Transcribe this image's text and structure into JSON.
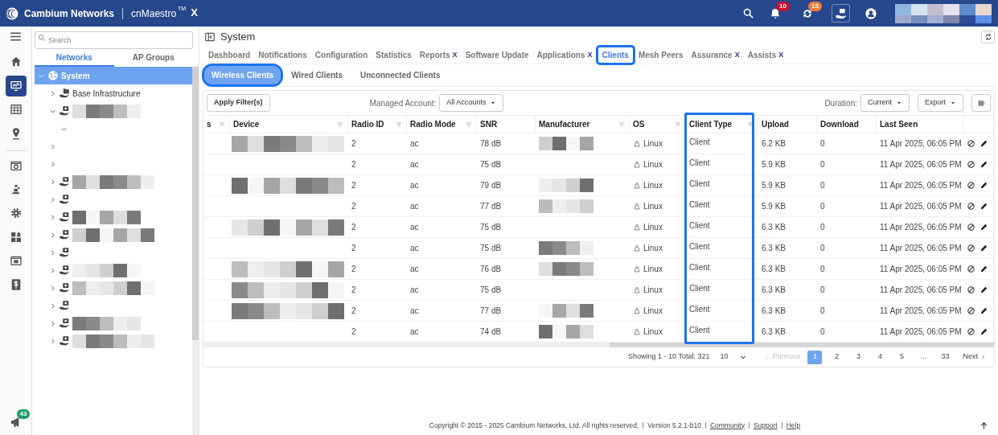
{
  "top_bar": {
    "brand": "Cambium Networks",
    "product": "cnMaestro",
    "trademark": "TM",
    "product_suffix": "X",
    "notifications_badge": "10",
    "sync_badge": "15"
  },
  "rail": {
    "items": [
      {
        "kind": "home",
        "selected": false
      },
      {
        "kind": "monitor",
        "selected": true
      },
      {
        "kind": "table",
        "selected": false
      },
      {
        "kind": "pin",
        "selected": false
      },
      {
        "kind": "dashboard",
        "selected": false
      },
      {
        "kind": "people",
        "selected": false
      },
      {
        "kind": "gear",
        "selected": false
      },
      {
        "kind": "apps",
        "selected": false
      },
      {
        "kind": "camera",
        "selected": false
      },
      {
        "kind": "dollar",
        "selected": false
      }
    ],
    "announce_badge": "43"
  },
  "tree_panel": {
    "search": {
      "placeholder": "Search"
    },
    "tabs": [
      {
        "label": "Networks",
        "selected": true
      },
      {
        "label": "AP Groups",
        "selected": false
      }
    ],
    "tree": [
      {
        "label": "System",
        "kind": "system",
        "expanded": true,
        "selected": true,
        "children": [
          {
            "label": "Base Infrastructure",
            "kind": "folder",
            "expanded": false,
            "selected": false
          },
          {
            "kind": "network",
            "expanded": true,
            "selected": false,
            "children": [
              {
                "expanded": true,
                "selected": false
              }
            ]
          },
          {
            "expanded": false,
            "selected": false
          },
          {
            "expanded": false,
            "selected": false
          },
          {
            "kind": "network",
            "expanded": false,
            "selected": false
          },
          {
            "kind": "network",
            "expanded": false,
            "selected": false
          },
          {
            "kind": "network",
            "expanded": false,
            "selected": false
          },
          {
            "kind": "network",
            "expanded": false,
            "selected": false
          },
          {
            "kind": "network",
            "expanded": false,
            "selected": false
          },
          {
            "kind": "network",
            "expanded": false,
            "selected": false
          },
          {
            "kind": "network",
            "expanded": false,
            "selected": false
          },
          {
            "kind": "network",
            "expanded": false,
            "selected": false
          },
          {
            "kind": "network",
            "expanded": false,
            "selected": false
          },
          {
            "kind": "network",
            "expanded": false,
            "selected": false
          }
        ]
      }
    ]
  },
  "page": {
    "title": "System",
    "tabs": [
      {
        "label": "Dashboard",
        "selected": false,
        "highlighted": false
      },
      {
        "label": "Notifications",
        "selected": false,
        "highlighted": false
      },
      {
        "label": "Configuration",
        "selected": false,
        "highlighted": false
      },
      {
        "label": "Statistics",
        "selected": false,
        "highlighted": false
      },
      {
        "label": "Reports",
        "suffix": "X",
        "selected": false,
        "highlighted": false
      },
      {
        "label": "Software Update",
        "selected": false,
        "highlighted": false
      },
      {
        "label": "Applications",
        "suffix": "X",
        "selected": false,
        "highlighted": false
      },
      {
        "label": "Clients",
        "selected": true,
        "highlighted": true
      },
      {
        "label": "Mesh Peers",
        "selected": false,
        "highlighted": false
      },
      {
        "label": "Assurance",
        "suffix": "X",
        "selected": false,
        "highlighted": false
      },
      {
        "label": "Assists",
        "suffix": "X",
        "selected": false,
        "highlighted": false
      }
    ],
    "subtabs": [
      {
        "label": "Wireless Clients",
        "selected": true,
        "highlighted": true
      },
      {
        "label": "Wired Clients",
        "selected": false,
        "highlighted": false
      },
      {
        "label": "Unconnected Clients",
        "selected": false,
        "highlighted": false
      }
    ]
  },
  "toolbar": {
    "apply_button": "Apply Filter(s)",
    "managed_account_label": "Managed Account:",
    "managed_account": "All Accounts",
    "duration_label": "Duration:",
    "duration": "Current",
    "export_button": "Export"
  },
  "table": {
    "columns": [
      {
        "label": "s",
        "filter": true,
        "highlighted": false
      },
      {
        "label": "Device",
        "filter": true,
        "highlighted": false
      },
      {
        "label": "Radio ID",
        "filter": true,
        "highlighted": false
      },
      {
        "label": "Radio Mode",
        "filter": true,
        "highlighted": false
      },
      {
        "label": "SNR",
        "filter": false,
        "highlighted": false
      },
      {
        "label": "Manufacturer",
        "filter": true,
        "highlighted": false
      },
      {
        "label": "OS",
        "filter": true,
        "highlighted": false
      },
      {
        "label": "Client Type",
        "filter": true,
        "highlighted": true
      },
      {
        "label": "Upload",
        "filter": false,
        "highlighted": false
      },
      {
        "label": "Download",
        "filter": false,
        "highlighted": false
      },
      {
        "label": "Last Seen",
        "filter": false,
        "highlighted": false
      }
    ],
    "rows": [
      {
        "radio_id": "2",
        "radio_mode": "ac",
        "snr": "78 dB",
        "os": "Linux",
        "client_type": "Client",
        "upload": "6.2 KB",
        "download": "0",
        "last_seen": "11 Apr 2025, 06:05 PM"
      },
      {
        "radio_id": "2",
        "radio_mode": "ac",
        "snr": "75 dB",
        "os": "Linux",
        "client_type": "Client",
        "upload": "5.9 KB",
        "download": "0",
        "last_seen": "11 Apr 2025, 06:05 PM"
      },
      {
        "radio_id": "2",
        "radio_mode": "ac",
        "snr": "79 dB",
        "os": "Linux",
        "client_type": "Client",
        "upload": "5.9 KB",
        "download": "0",
        "last_seen": "11 Apr 2025, 06:05 PM"
      },
      {
        "radio_id": "2",
        "radio_mode": "ac",
        "snr": "77 dB",
        "os": "Linux",
        "client_type": "Client",
        "upload": "5.9 KB",
        "download": "0",
        "last_seen": "11 Apr 2025, 06:05 PM"
      },
      {
        "radio_id": "2",
        "radio_mode": "ac",
        "snr": "75 dB",
        "os": "Linux",
        "client_type": "Client",
        "upload": "6.3 KB",
        "download": "0",
        "last_seen": "11 Apr 2025, 06:05 PM"
      },
      {
        "radio_id": "2",
        "radio_mode": "ac",
        "snr": "75 dB",
        "os": "Linux",
        "client_type": "Client",
        "upload": "6.3 KB",
        "download": "0",
        "last_seen": "11 Apr 2025, 06:05 PM"
      },
      {
        "radio_id": "2",
        "radio_mode": "ac",
        "snr": "76 dB",
        "os": "Linux",
        "client_type": "Client",
        "upload": "6.3 KB",
        "download": "0",
        "last_seen": "11 Apr 2025, 06:05 PM"
      },
      {
        "radio_id": "2",
        "radio_mode": "ac",
        "snr": "75 dB",
        "os": "Linux",
        "client_type": "Client",
        "upload": "6.3 KB",
        "download": "0",
        "last_seen": "11 Apr 2025, 06:05 PM"
      },
      {
        "radio_id": "2",
        "radio_mode": "ac",
        "snr": "77 dB",
        "os": "Linux",
        "client_type": "Client",
        "upload": "6.3 KB",
        "download": "0",
        "last_seen": "11 Apr 2025, 06:05 PM"
      },
      {
        "radio_id": "2",
        "radio_mode": "ac",
        "snr": "74 dB",
        "os": "Linux",
        "client_type": "Client",
        "upload": "6.3 KB",
        "download": "0",
        "last_seen": "11 Apr 2025, 06:05 PM"
      }
    ]
  },
  "pagination": {
    "summary": "Showing 1 - 10 Total: 321",
    "page_size": "10",
    "previous": "Previous",
    "previous_disabled": true,
    "pages": [
      {
        "label": "1",
        "selected": true
      },
      {
        "label": "2",
        "selected": false
      },
      {
        "label": "3",
        "selected": false
      },
      {
        "label": "4",
        "selected": false
      },
      {
        "label": "5",
        "selected": false
      },
      {
        "label": "...",
        "selected": false
      },
      {
        "label": "33",
        "selected": false
      }
    ],
    "next": "Next"
  },
  "footer": {
    "copyright": "Copyright © 2015 - 2025 Cambium Networks, Ltd. All rights reserved.",
    "version": "Version 5.2.1-b10",
    "links": [
      "Community",
      "Support",
      "Help"
    ]
  }
}
